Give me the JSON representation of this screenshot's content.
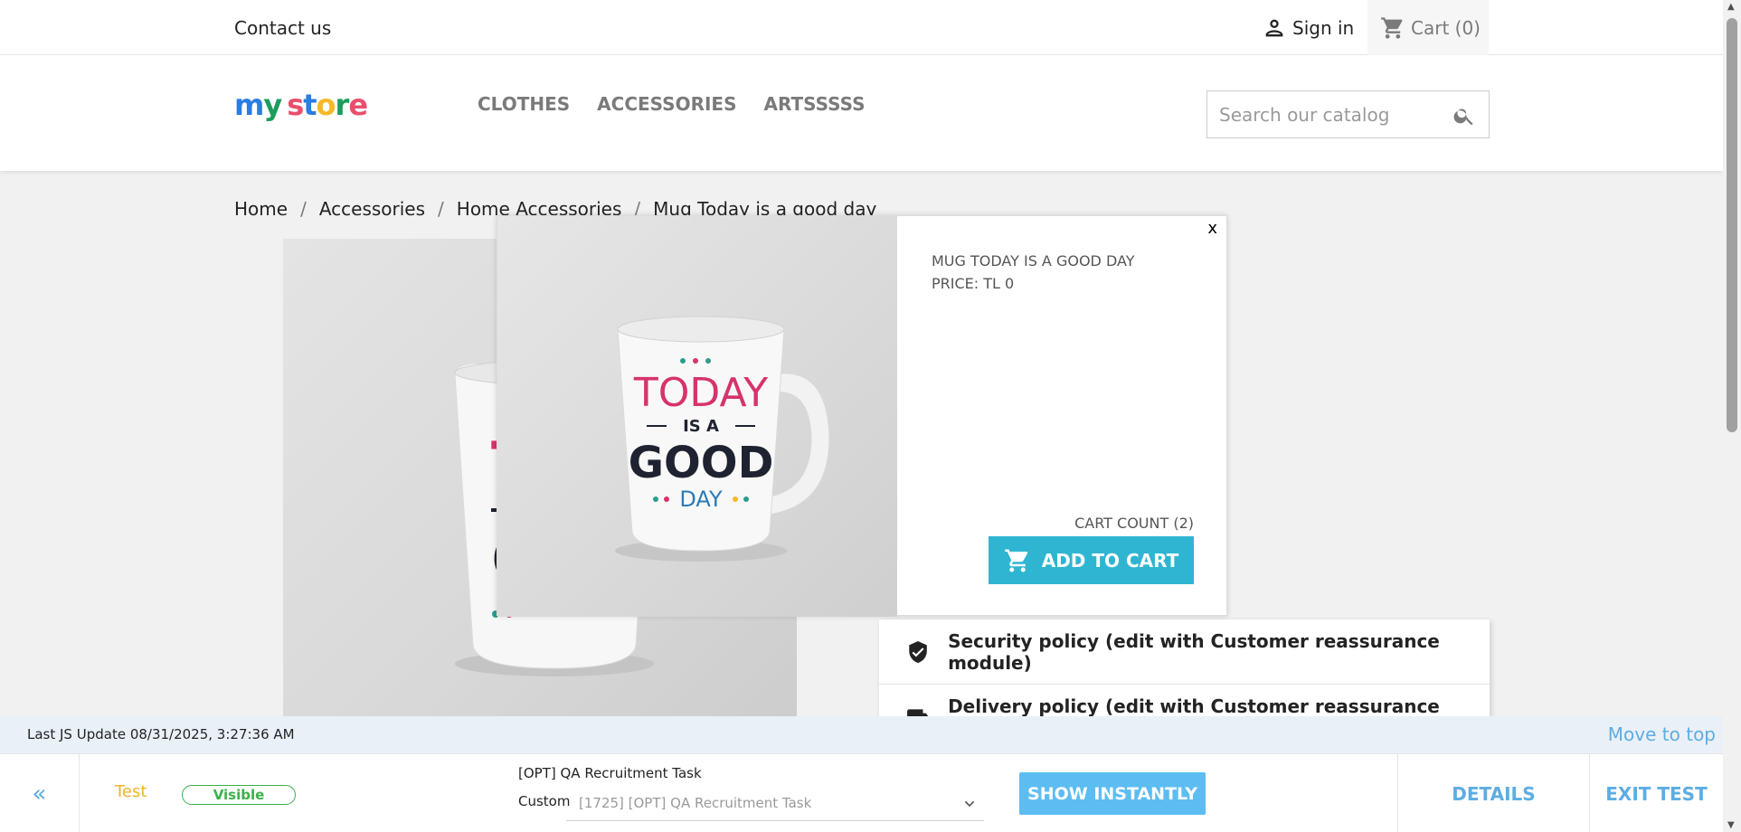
{
  "topbar": {
    "contact": "Contact us",
    "signin": "Sign in",
    "cart": "Cart (0)"
  },
  "header": {
    "logo": "my store",
    "nav": [
      "CLOTHES",
      "ACCESSORIES",
      "ARTSSSSS"
    ],
    "search_placeholder": "Search our catalog"
  },
  "breadcrumb": [
    "Home",
    "Accessories",
    "Home Accessories",
    "Mug Today is a good day"
  ],
  "popup": {
    "close": "x",
    "title": "MUG TODAY IS A GOOD DAY",
    "price": "PRICE: TL 0",
    "cart_count": "CART COUNT (2)",
    "add_to_cart": "ADD TO CART"
  },
  "mug_text": {
    "line1": "TODAY",
    "line2": "IS A",
    "line3": "GOOD",
    "line4": "DAY"
  },
  "reassurance": [
    "Security policy (edit with Customer reassurance module)",
    "Delivery policy (edit with Customer reassurance module)"
  ],
  "debug": {
    "last_update": "Last JS Update 08/31/2025, 3:27:36 AM",
    "move_to_top": "Move to top"
  },
  "toolbar": {
    "back": "«",
    "test": "Test",
    "visible": "Visible",
    "task_title": "[OPT] QA Recruitment Task",
    "custom_label": "Custom",
    "select_value": "[1725] [OPT] QA Recruitment Task",
    "show_instantly": "SHOW INSTANTLY",
    "details": "DETAILS",
    "exit": "EXIT TEST"
  },
  "colors": {
    "accent": "#2fb5d2",
    "toolbar_accent": "#5dade2",
    "visible_badge": "#3cb04a",
    "test_label": "#f0b429",
    "mug_red": "#d6336c",
    "mug_dark": "#1f2230",
    "mug_blue": "#2c7bb6"
  }
}
